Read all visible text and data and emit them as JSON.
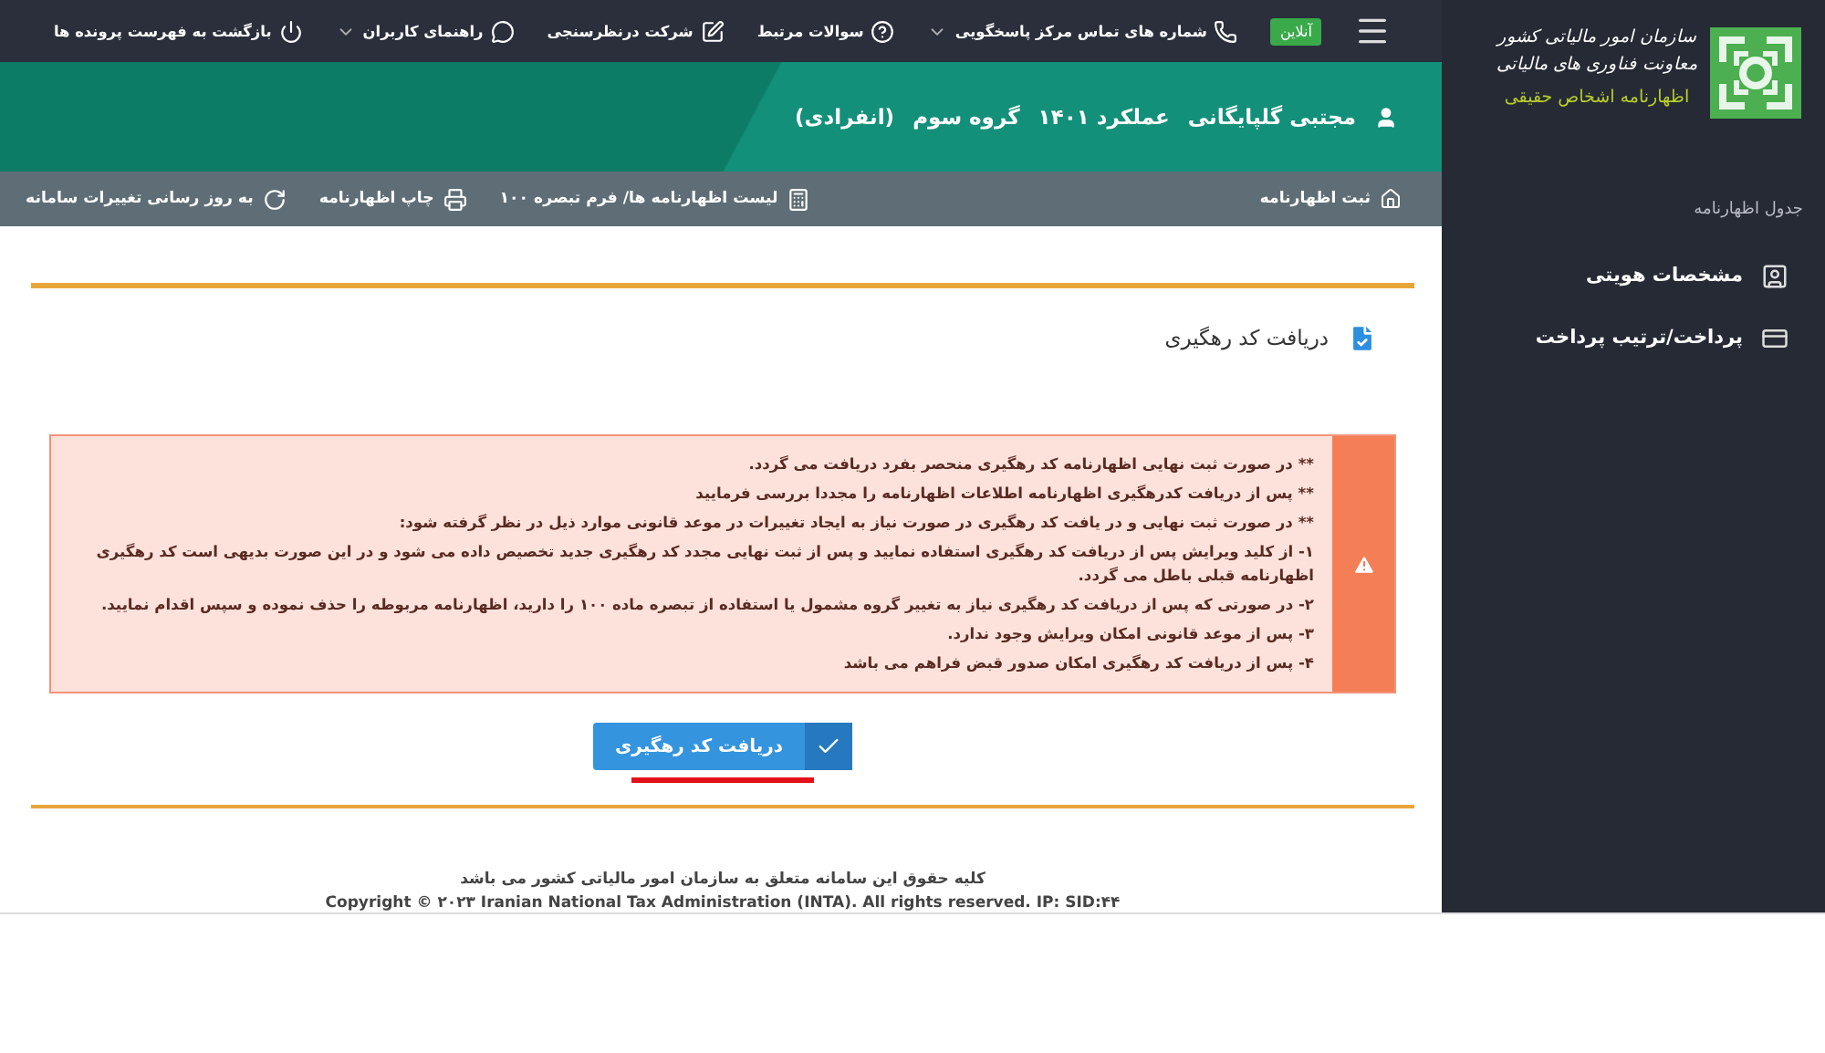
{
  "sidebar": {
    "org_lines": [
      "سازمان امور مالیاتی کشور",
      "معاونت فناوری های مالیاتی"
    ],
    "subtitle": "اظهارنامه اشخاص حقیقی",
    "section_title": "جدول اظهارنامه",
    "items": [
      {
        "label": "مشخصات هویتی",
        "selected": false
      },
      {
        "label": "پرداخت/ترتیب پرداخت",
        "selected": false
      }
    ]
  },
  "top_bar": {
    "status": "آنلاین",
    "items": [
      {
        "label": "شماره های تماس مرکز پاسخگویی",
        "dropdown": true
      },
      {
        "label": "سوالات مرتبط",
        "dropdown": false
      },
      {
        "label": "شرکت درنظرسنجی",
        "dropdown": false
      },
      {
        "label": "راهنمای کاربران",
        "dropdown": true
      },
      {
        "label": "بازگشت به فهرست پرونده ها",
        "dropdown": false
      }
    ]
  },
  "header": {
    "name": "مجتبی گلپایگانی",
    "year": "عملکرد ۱۴۰۱",
    "group": "گروه سوم",
    "type": "(انفرادی)"
  },
  "breadcrumb": {
    "current": "ثبت اظهارنامه",
    "actions": [
      {
        "label": "لیست اظهارنامه ها/ فرم تبصره ۱۰۰"
      },
      {
        "label": "چاپ اظهارنامه"
      },
      {
        "label": "به روز رسانی تغییرات سامانه"
      }
    ]
  },
  "card": {
    "title": "دریافت کد رهگیری",
    "alert_lines": [
      "** در صورت ثبت نهایی اظهارنامه کد رهگیری منحصر بفرد دریافت می گردد.",
      "** پس از دریافت کدرهگیری اظهارنامه اطلاعات اظهارنامه را مجددا بررسی فرمایید",
      "** در صورت ثبت نهایی و در یافت کد رهگیری در صورت نیاز به ایجاد تغییرات در موعد قانونی موارد ذیل در نظر گرفته شود:",
      "۱- از کلید ویرایش پس از دریافت کد رهگیری استفاده نمایید و پس از ثبت نهایی مجدد کد رهگیری جدید تخصیص داده می شود و در این صورت بدیهی است کد رهگیری اظهارنامه قبلی باطل می گردد.",
      "۲- در صورتی که پس از دریافت کد رهگیری نیاز به تغییر گروه مشمول یا استفاده از تبصره ماده ۱۰۰ را دارید، اظهارنامه مربوطه را حذف نموده و سپس اقدام نمایید.",
      "۳- پس از موعد قانونی امکان ویرایش وجود ندارد.",
      "۴- پس از دریافت کد رهگیری امکان صدور قبض فراهم می باشد"
    ],
    "button": "دریافت کد رهگیری"
  },
  "footer": {
    "rights": "کلیه حقوق این سامانه متعلق به سازمان امور مالیاتی کشور می باشد",
    "copyright": "Copyright © ۲۰۲۳ Iranian National Tax Administration (INTA). All rights reserved. IP: SID:۴۴"
  }
}
